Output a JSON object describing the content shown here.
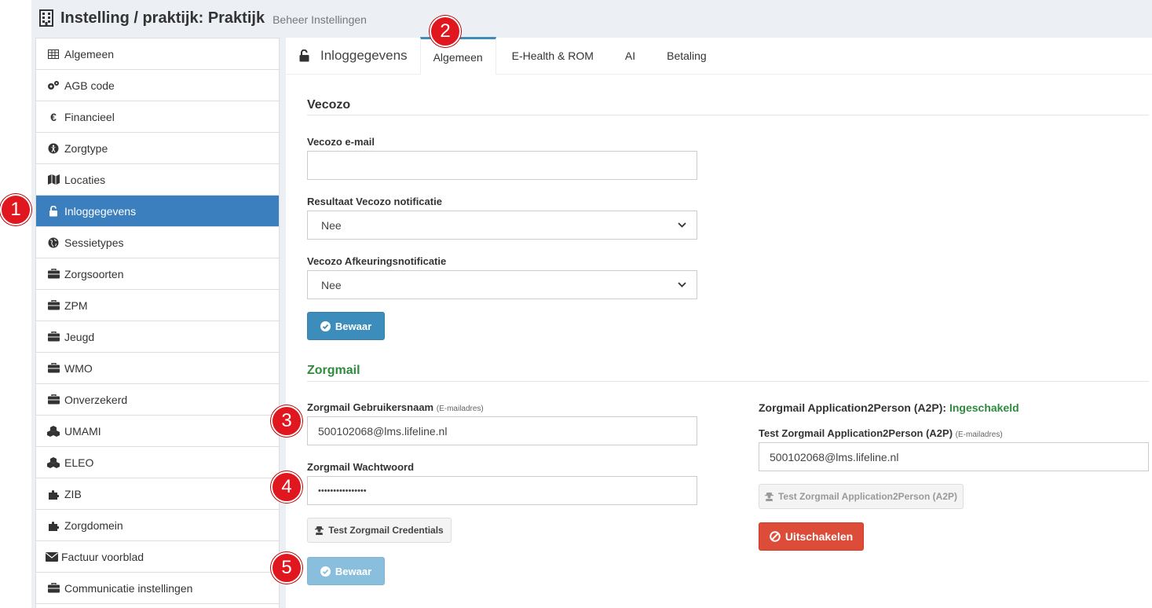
{
  "header": {
    "title": "Instelling / praktijk: Praktijk",
    "subtitle": "Beheer Instellingen"
  },
  "sidebar": {
    "items": [
      {
        "label": "Algemeen",
        "icon": "table-icon"
      },
      {
        "label": "AGB code",
        "icon": "cogs-icon"
      },
      {
        "label": "Financieel",
        "icon": "euro-icon"
      },
      {
        "label": "Zorgtype",
        "icon": "accessibility-icon"
      },
      {
        "label": "Locaties",
        "icon": "map-icon"
      },
      {
        "label": "Inloggegevens",
        "icon": "unlock-icon",
        "active": true
      },
      {
        "label": "Sessietypes",
        "icon": "globe-icon"
      },
      {
        "label": "Zorgsoorten",
        "icon": "briefcase-icon"
      },
      {
        "label": "ZPM",
        "icon": "briefcase-icon"
      },
      {
        "label": "Jeugd",
        "icon": "briefcase-icon"
      },
      {
        "label": "WMO",
        "icon": "briefcase-icon"
      },
      {
        "label": "Onverzekerd",
        "icon": "briefcase-icon"
      },
      {
        "label": "UMAMI",
        "icon": "cubes-icon"
      },
      {
        "label": "ELEO",
        "icon": "cubes-icon"
      },
      {
        "label": "ZIB",
        "icon": "puzzle-icon"
      },
      {
        "label": "Zorgdomein",
        "icon": "puzzle-icon"
      },
      {
        "label": "Factuur voorblad",
        "icon": "envelope-icon"
      },
      {
        "label": "Communicatie instellingen",
        "icon": "briefcase-icon"
      }
    ]
  },
  "tabs": {
    "title": "Inloggegevens",
    "items": [
      {
        "label": "Algemeen",
        "active": true
      },
      {
        "label": "E-Health & ROM"
      },
      {
        "label": "AI"
      },
      {
        "label": "Betaling"
      }
    ]
  },
  "vecozo": {
    "title": "Vecozo",
    "email_label": "Vecozo e-mail",
    "email_value": "",
    "result_label": "Resultaat Vecozo notificatie",
    "result_value": "Nee",
    "reject_label": "Vecozo Afkeuringsnotificatie",
    "reject_value": "Nee",
    "save_label": "Bewaar"
  },
  "zorgmail": {
    "title": "Zorgmail",
    "user_label": "Zorgmail Gebruikersnaam",
    "user_hint": "(E-mailadres)",
    "user_value": "500102068@lms.lifeline.nl",
    "pass_label": "Zorgmail Wachtwoord",
    "pass_value": "••••••••••••••••",
    "test_label": "Test Zorgmail Credentials",
    "save_label": "Bewaar",
    "a2p_label": "Zorgmail Application2Person (A2P):",
    "a2p_status": "Ingeschakeld",
    "a2p_test_label": "Test Zorgmail Application2Person (A2P)",
    "a2p_test_hint": "(E-mailadres)",
    "a2p_test_value": "500102068@lms.lifeline.nl",
    "a2p_test_button": "Test Zorgmail Application2Person (A2P)",
    "disable_label": "Uitschakelen"
  },
  "markers": [
    "1",
    "2",
    "3",
    "4",
    "5"
  ],
  "colors": {
    "primary": "#3c8dbc",
    "active_sidebar": "#3c7fbf",
    "success": "#2e8b3e",
    "danger": "#dd4b39",
    "marker": "#e0171f"
  }
}
